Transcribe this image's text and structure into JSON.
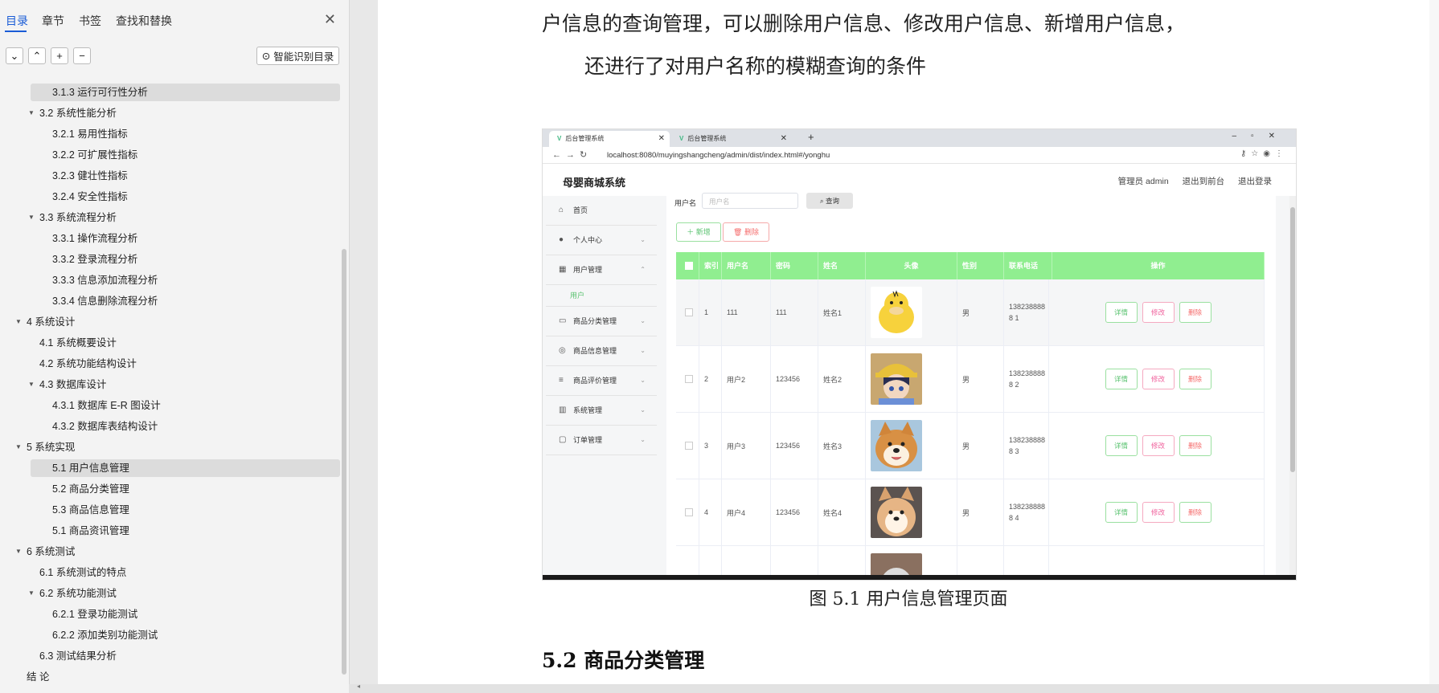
{
  "nav": {
    "tabs": [
      "目录",
      "章节",
      "书签",
      "查找和替换"
    ],
    "toolbar": {
      "collapse_icon": "chevron-down-icon",
      "expand_icon": "chevron-up-icon",
      "add_icon": "plus-icon",
      "remove_icon": "minus-icon",
      "smart_button": "智能识别目录"
    },
    "toc": [
      {
        "label": "3.1.3  运行可行性分析",
        "level": 3,
        "selected": true
      },
      {
        "label": "3.2  系统性能分析",
        "level": 2,
        "expanded": true
      },
      {
        "label": "3.2.1  易用性指标",
        "level": 3
      },
      {
        "label": "3.2.2  可扩展性指标",
        "level": 3
      },
      {
        "label": "3.2.3  健壮性指标",
        "level": 3
      },
      {
        "label": "3.2.4  安全性指标",
        "level": 3
      },
      {
        "label": "3.3  系统流程分析",
        "level": 2,
        "expanded": true
      },
      {
        "label": "3.3.1  操作流程分析",
        "level": 3
      },
      {
        "label": "3.3.2  登录流程分析",
        "level": 3
      },
      {
        "label": "3.3.3  信息添加流程分析",
        "level": 3
      },
      {
        "label": "3.3.4  信息删除流程分析",
        "level": 3
      },
      {
        "label": "4  系统设计",
        "level": 1,
        "expanded": true
      },
      {
        "label": "4.1  系统概要设计",
        "level": 2
      },
      {
        "label": "4.2  系统功能结构设计",
        "level": 2
      },
      {
        "label": "4.3  数据库设计",
        "level": 2,
        "expanded": true
      },
      {
        "label": "4.3.1  数据库 E-R 图设计",
        "level": 3
      },
      {
        "label": "4.3.2  数据库表结构设计",
        "level": 3
      },
      {
        "label": "5  系统实现",
        "level": 1,
        "expanded": true
      },
      {
        "label": "5.1 用户信息管理",
        "level": 3,
        "selected": true
      },
      {
        "label": "5.2  商品分类管理",
        "level": 3
      },
      {
        "label": "5.3 商品信息管理",
        "level": 3
      },
      {
        "label": "5.1 商品资讯管理",
        "level": 3
      },
      {
        "label": "6  系统测试",
        "level": 1,
        "expanded": true
      },
      {
        "label": "6.1  系统测试的特点",
        "level": 2
      },
      {
        "label": "6.2  系统功能测试",
        "level": 2,
        "expanded": true
      },
      {
        "label": "6.2.1  登录功能测试",
        "level": 3
      },
      {
        "label": "6.2.2  添加类别功能测试",
        "level": 3
      },
      {
        "label": "6.3  测试结果分析",
        "level": 2
      },
      {
        "label": "结    论",
        "level": 0
      }
    ]
  },
  "doc": {
    "para_line1": "户信息的查询管理，可以删除用户信息、修改用户信息、新增用户信息，",
    "para_line2": "还进行了对用户名称的模糊查询的条件",
    "caption": "图 5.1  用户信息管理页面",
    "heading": "5.2  商品分类管理"
  },
  "screenshot": {
    "browser": {
      "tabs": [
        "后台管理系统",
        "后台管理系统"
      ],
      "url": "localhost:8080/muyingshangcheng/admin/dist/index.html#/yonghu"
    },
    "app": {
      "title": "母婴商城系统",
      "header_links": [
        "管理员 admin",
        "退出到前台",
        "退出登录"
      ],
      "sidebar": [
        {
          "label": "首页",
          "icon": "home-icon",
          "chevron": false
        },
        {
          "label": "个人中心",
          "icon": "user-icon",
          "chevron": true
        },
        {
          "label": "用户管理",
          "icon": "grid-icon",
          "chevron": true,
          "open": true
        },
        {
          "label": "商品分类管理",
          "icon": "card-icon",
          "chevron": true
        },
        {
          "label": "商品信息管理",
          "icon": "compass-icon",
          "chevron": true
        },
        {
          "label": "商品评价管理",
          "icon": "sliders-icon",
          "chevron": true
        },
        {
          "label": "系统管理",
          "icon": "chart-icon",
          "chevron": true
        },
        {
          "label": "订单管理",
          "icon": "chat-icon",
          "chevron": true
        }
      ],
      "sidebar_sub": "用户",
      "search": {
        "label": "用户名",
        "placeholder": "用户名",
        "button": "查询"
      },
      "add_button": "＋ 新增",
      "delete_button": "删除",
      "columns": [
        "索引",
        "用户名",
        "密码",
        "姓名",
        "头像",
        "性别",
        "联系电话",
        "操作"
      ],
      "rows": [
        {
          "index": "1",
          "username": "111",
          "password": "111",
          "name": "姓名1",
          "gender": "男",
          "phone": "1382388888 1"
        },
        {
          "index": "2",
          "username": "用户2",
          "password": "123456",
          "name": "姓名2",
          "gender": "男",
          "phone": "1382388888 2"
        },
        {
          "index": "3",
          "username": "用户3",
          "password": "123456",
          "name": "姓名3",
          "gender": "男",
          "phone": "1382388888 3"
        },
        {
          "index": "4",
          "username": "用户4",
          "password": "123456",
          "name": "姓名4",
          "gender": "男",
          "phone": "1382388888 4"
        }
      ],
      "row_actions": [
        "详情",
        "修改",
        "删除"
      ]
    }
  },
  "colors": {
    "accent": "#1a5cd6",
    "table_header": "#90ee90",
    "green": "#59c26f",
    "red": "#f56c6c",
    "pink": "#f0619c"
  }
}
